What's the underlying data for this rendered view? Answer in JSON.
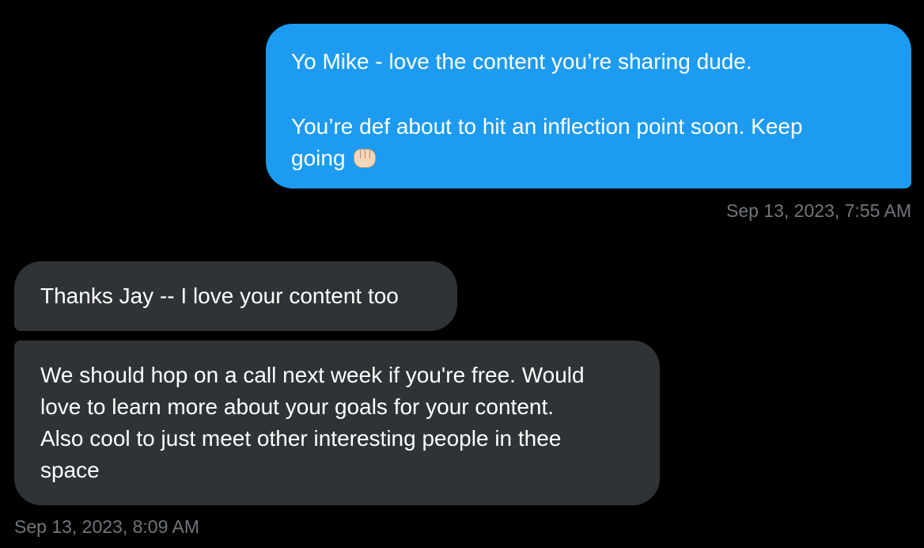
{
  "conversation": {
    "messages": [
      {
        "direction": "sent",
        "lines": [
          "Yo Mike - love the content you’re sharing dude.",
          "You’re def about to hit an inflection point soon. Keep",
          "going"
        ],
        "emoji": "oncoming-fist-emoji",
        "timestamp": "Sep 13, 2023, 7:55 AM"
      },
      {
        "direction": "received",
        "lines": [
          "Thanks Jay -- I love your content too"
        ]
      },
      {
        "direction": "received",
        "lines": [
          "We should hop on a call next week if you're free. Would",
          "love to learn more about your goals for your content.",
          "Also cool to just meet other interesting people in thee",
          "space"
        ],
        "timestamp": "Sep 13, 2023, 8:09 AM"
      }
    ]
  },
  "colors": {
    "background": "#000000",
    "sent_bubble": "#1d9bf0",
    "received_bubble": "#2f3336",
    "timestamp_text": "#71767b",
    "message_text": "#ffffff"
  }
}
